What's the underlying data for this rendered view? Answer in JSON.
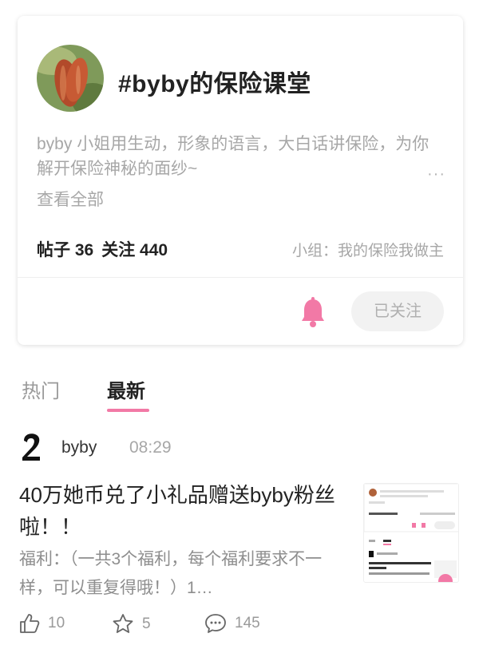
{
  "topic": {
    "title": "#byby的保险课堂",
    "description": "byby 小姐用生动，形象的语言，大白话讲保险，为你解开保险神秘的面纱~",
    "view_all": "查看全部",
    "posts_label": "帖子 36",
    "follows_label": "关注 440",
    "group_label": "小组：我的保险我做主",
    "follow_button": "已关注",
    "more_glyph": "···"
  },
  "tabs": [
    {
      "label": "热门",
      "active": false
    },
    {
      "label": "最新",
      "active": true
    }
  ],
  "post": {
    "user": "byby",
    "time": "08:29",
    "title": "40万她币兑了小礼品赠送byby粉丝啦！！",
    "excerpt": "福利：（一共3个福利，每个福利要求不一样，可以重复得哦！）1…",
    "likes": "10",
    "favorites": "5",
    "comments": "145"
  },
  "colors": {
    "accent": "#f279a6",
    "text_primary": "#222222",
    "text_secondary": "#a7a7a7"
  },
  "icons": [
    "bell-icon",
    "like-icon",
    "star-icon",
    "comment-icon",
    "more-icon"
  ]
}
